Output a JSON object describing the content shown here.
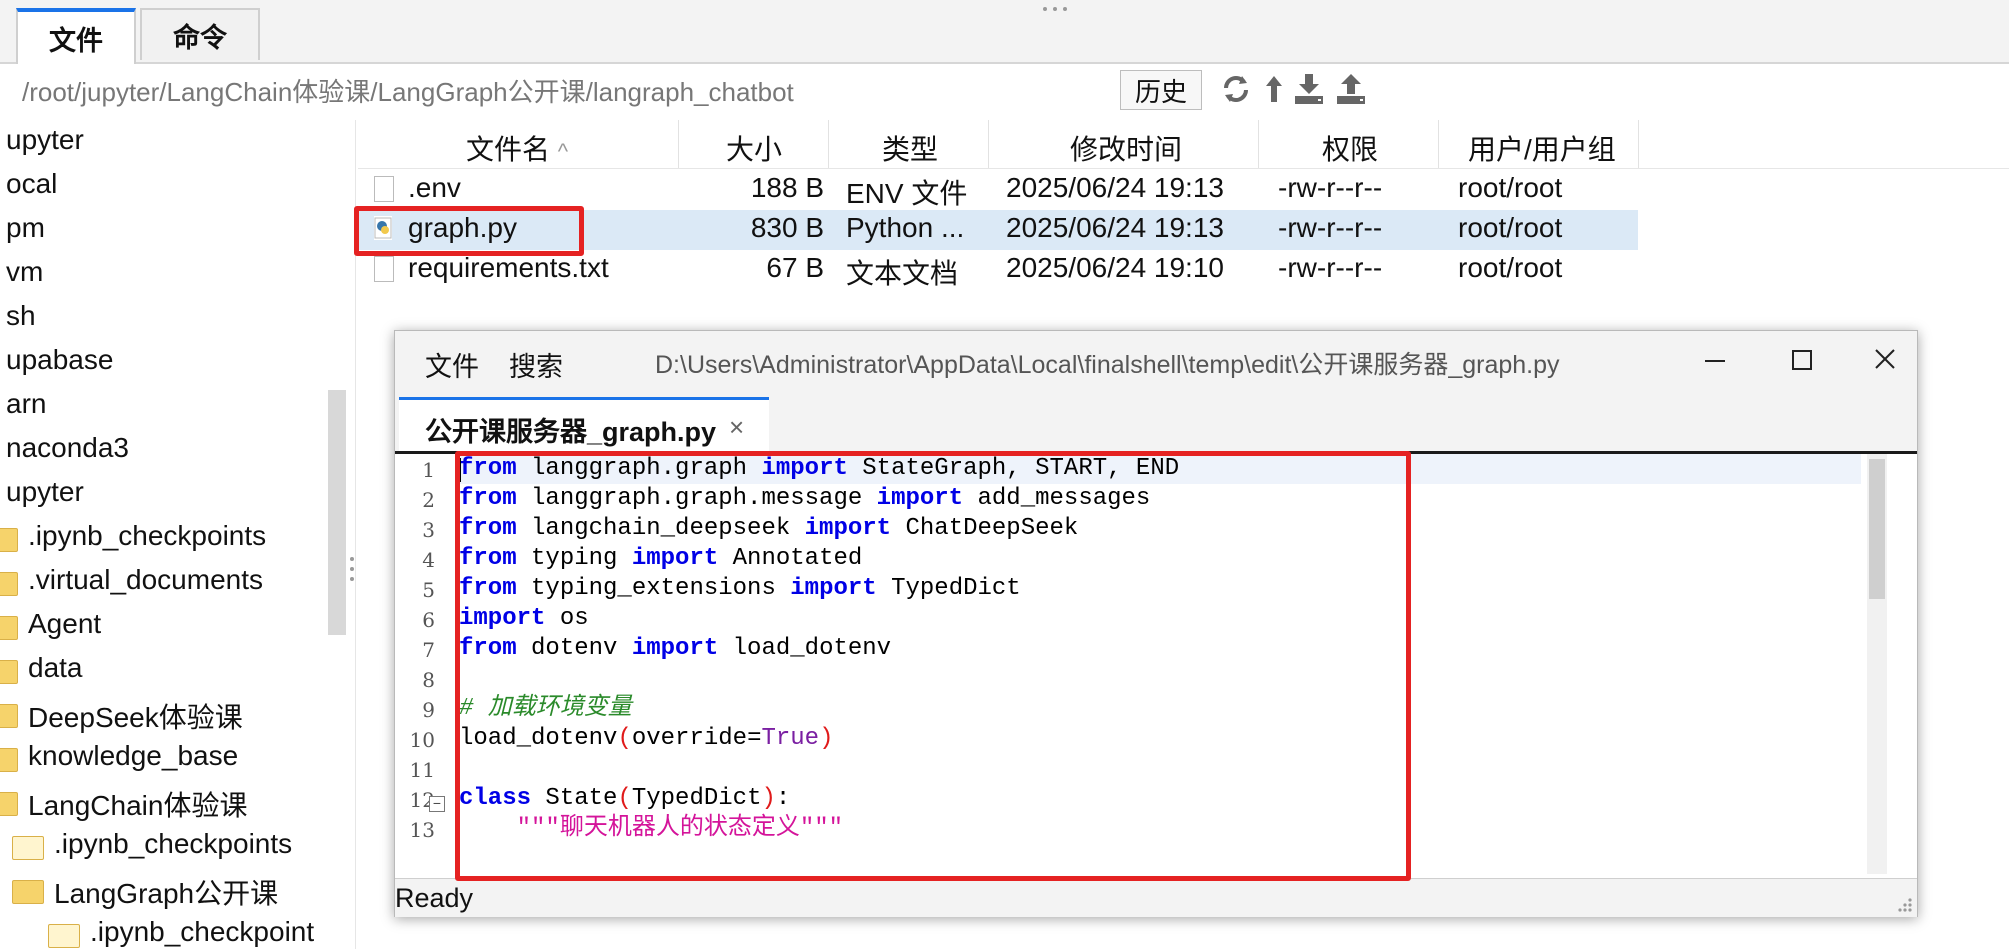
{
  "top_tabs": [
    {
      "label": "文件",
      "active": true
    },
    {
      "label": "命令",
      "active": false
    }
  ],
  "path": "/root/jupyter/LangChain体验课/LangGraph公开课/langraph_chatbot",
  "history_label": "历史",
  "toolbar_icons": [
    "refresh-icon",
    "up-arrow-icon",
    "download-icon",
    "upload-icon"
  ],
  "tree": [
    {
      "label": "upyter",
      "folder": false
    },
    {
      "label": "ocal",
      "folder": false
    },
    {
      "label": "pm",
      "folder": false
    },
    {
      "label": "vm",
      "folder": false
    },
    {
      "label": "sh",
      "folder": false
    },
    {
      "label": "upabase",
      "folder": false
    },
    {
      "label": "arn",
      "folder": false
    },
    {
      "label": "naconda3",
      "folder": false
    },
    {
      "label": "upyter",
      "folder": false
    },
    {
      "label": ".ipynb_checkpoints",
      "folder": true
    },
    {
      "label": ".virtual_documents",
      "folder": true
    },
    {
      "label": "Agent",
      "folder": true
    },
    {
      "label": "data",
      "folder": true
    },
    {
      "label": "DeepSeek体验课",
      "folder": true
    },
    {
      "label": "knowledge_base",
      "folder": true
    },
    {
      "label": "LangChain体验课",
      "folder": true
    },
    {
      "label": ".ipynb_checkpoints",
      "folder": true
    },
    {
      "label": "LangGraph公开课",
      "folder": true
    },
    {
      "label": ".ipynb_checkpoint",
      "folder": true
    }
  ],
  "table": {
    "headers": [
      "文件名",
      "大小",
      "类型",
      "修改时间",
      "权限",
      "用户/用户组"
    ],
    "sort_indicator": "^",
    "rows": [
      {
        "name": ".env",
        "size": "188 B",
        "type": "ENV 文件",
        "mtime": "2025/06/24 19:13",
        "perm": "-rw-r--r--",
        "owner": "root/root",
        "selected": false
      },
      {
        "name": "graph.py",
        "size": "830 B",
        "type": "Python ...",
        "mtime": "2025/06/24 19:13",
        "perm": "-rw-r--r--",
        "owner": "root/root",
        "selected": true
      },
      {
        "name": "requirements.txt",
        "size": "67 B",
        "type": "文本文档",
        "mtime": "2025/06/24 19:10",
        "perm": "-rw-r--r--",
        "owner": "root/root",
        "selected": false
      }
    ]
  },
  "editor": {
    "menu": [
      "文件",
      "搜索"
    ],
    "title": "D:\\Users\\Administrator\\AppData\\Local\\finalshell\\temp\\edit\\公开课服务器_graph.py",
    "tab_label": "公开课服务器_graph.py",
    "tab_close": "×",
    "status": "Ready",
    "line_numbers": [
      "1",
      "2",
      "3",
      "4",
      "5",
      "6",
      "7",
      "8",
      "9",
      "10",
      "11",
      "12",
      "13"
    ],
    "code_lines": [
      [
        {
          "t": "from",
          "c": "kw"
        },
        {
          "t": " langgraph.graph ",
          "c": ""
        },
        {
          "t": "import",
          "c": "kw"
        },
        {
          "t": " StateGraph, START, END",
          "c": ""
        }
      ],
      [
        {
          "t": "from",
          "c": "kw"
        },
        {
          "t": " langgraph.graph.message ",
          "c": ""
        },
        {
          "t": "import",
          "c": "kw"
        },
        {
          "t": " add_messages",
          "c": ""
        }
      ],
      [
        {
          "t": "from",
          "c": "kw"
        },
        {
          "t": " langchain_deepseek ",
          "c": ""
        },
        {
          "t": "import",
          "c": "kw"
        },
        {
          "t": " ChatDeepSeek",
          "c": ""
        }
      ],
      [
        {
          "t": "from",
          "c": "kw"
        },
        {
          "t": " typing ",
          "c": ""
        },
        {
          "t": "import",
          "c": "kw"
        },
        {
          "t": " Annotated",
          "c": ""
        }
      ],
      [
        {
          "t": "from",
          "c": "kw"
        },
        {
          "t": " typing_extensions ",
          "c": ""
        },
        {
          "t": "import",
          "c": "kw"
        },
        {
          "t": " TypedDict",
          "c": ""
        }
      ],
      [
        {
          "t": "import",
          "c": "kw"
        },
        {
          "t": " os",
          "c": ""
        }
      ],
      [
        {
          "t": "from",
          "c": "kw"
        },
        {
          "t": " dotenv ",
          "c": ""
        },
        {
          "t": "import",
          "c": "kw"
        },
        {
          "t": " load_dotenv",
          "c": ""
        }
      ],
      [],
      [
        {
          "t": "# 加载环境变量",
          "c": "cm"
        }
      ],
      [
        {
          "t": "load_dotenv",
          "c": ""
        },
        {
          "t": "(",
          "c": "paren"
        },
        {
          "t": "override=",
          "c": ""
        },
        {
          "t": "True",
          "c": "kwv"
        },
        {
          "t": ")",
          "c": "paren"
        }
      ],
      [],
      [
        {
          "t": "class",
          "c": "kw"
        },
        {
          "t": " State",
          "c": ""
        },
        {
          "t": "(",
          "c": "paren"
        },
        {
          "t": "TypedDict",
          "c": ""
        },
        {
          "t": ")",
          "c": "paren"
        },
        {
          "t": ":",
          "c": ""
        }
      ],
      [
        {
          "t": "    ",
          "c": ""
        },
        {
          "t": "\"\"\"聊天机器人的状态定义\"\"\"",
          "c": "str"
        }
      ]
    ]
  },
  "colors": {
    "accent": "#1a73e8",
    "highlight_box": "#e52222",
    "selected_row": "#dbe9f6",
    "keyword": "#0000e6",
    "comment": "#2a8a2a",
    "string": "#d4149a"
  }
}
